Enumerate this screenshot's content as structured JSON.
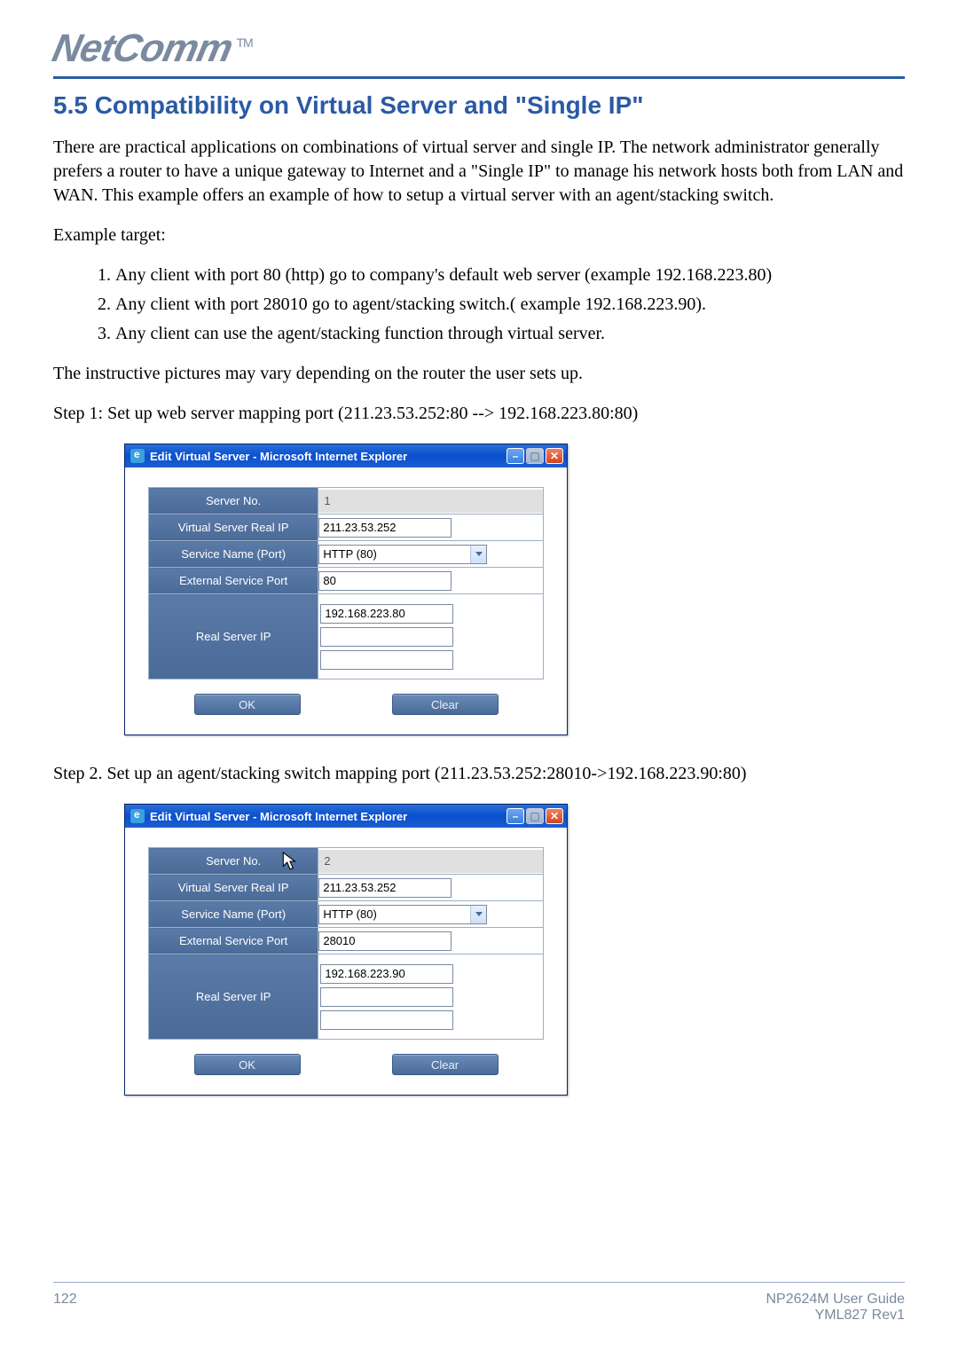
{
  "header": {
    "logo_text": "NetComm",
    "logo_tm": "TM"
  },
  "section": {
    "title": "5.5  Compatibility on Virtual Server and \"Single IP\"",
    "intro": "There are practical applications on combinations of virtual server and single IP.  The network administrator generally prefers a router to have a unique gateway to Internet and a \"Single IP\" to manage his network hosts both from LAN and WAN.  This example offers an example of how to setup a virtual server with an agent/stacking switch.",
    "example_target_label": "Example target:",
    "targets": [
      "Any client with port 80 (http) go to company's default web server (example 192.168.223.80)",
      "Any client with port 28010 go to agent/stacking switch.( example 192.168.223.90).",
      "Any client can use the agent/stacking function through virtual server."
    ],
    "note": "The instructive pictures may vary depending on the router the user sets up.",
    "step1": "Step 1:  Set up web server mapping port (211.23.53.252:80 --> 192.168.223.80:80)",
    "step2": "Step 2.  Set up an agent/stacking switch mapping port (211.23.53.252:28010->192.168.223.90:80)"
  },
  "dialog_common": {
    "title": "Edit Virtual Server - Microsoft Internet Explorer",
    "labels": {
      "server_no": "Server No.",
      "real_ip": "Virtual Server Real IP",
      "service_name": "Service Name (Port)",
      "ext_port": "External Service Port",
      "real_server_ip": "Real Server IP"
    },
    "service_option": "HTTP (80)",
    "ok_label": "OK",
    "clear_label": "Clear"
  },
  "dialog1": {
    "server_no": "1",
    "real_ip": "211.23.53.252",
    "ext_port": "80",
    "real_server_ip": "192.168.223.80"
  },
  "dialog2": {
    "server_no": "2",
    "real_ip": "211.23.53.252",
    "ext_port": "28010",
    "real_server_ip": "192.168.223.90"
  },
  "footer": {
    "page": "122",
    "guide": "NP2624M User Guide",
    "rev": "YML827 Rev1"
  }
}
